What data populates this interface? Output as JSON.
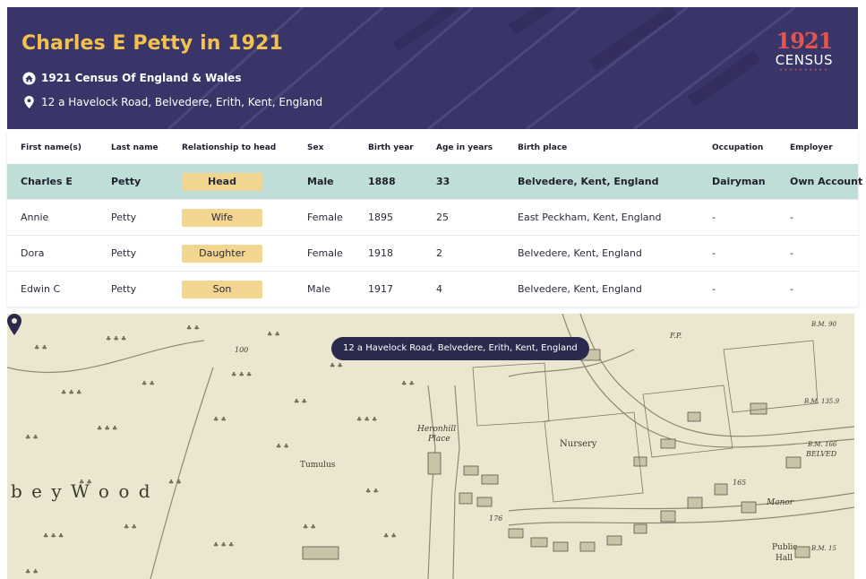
{
  "header": {
    "title": "Charles E Petty in 1921",
    "collection": "1921 Census Of England & Wales",
    "address": "12 a Havelock Road, Belvedere, Erith, Kent, England",
    "logo_year": "1921",
    "logo_word": "CENSUS"
  },
  "table": {
    "columns": [
      "First name(s)",
      "Last name",
      "Relationship to head",
      "Sex",
      "Birth year",
      "Age in years",
      "Birth place",
      "Occupation",
      "Employer"
    ],
    "rows": [
      {
        "first": "Charles E",
        "last": "Petty",
        "relationship": "Head",
        "sex": "Male",
        "birth_year": "1888",
        "age": "33",
        "birth_place": "Belvedere, Kent, England",
        "occupation": "Dairyman",
        "employer": "Own Account"
      },
      {
        "first": "Annie",
        "last": "Petty",
        "relationship": "Wife",
        "sex": "Female",
        "birth_year": "1895",
        "age": "25",
        "birth_place": "East Peckham, Kent, England",
        "occupation": "-",
        "employer": "-"
      },
      {
        "first": "Dora",
        "last": "Petty",
        "relationship": "Daughter",
        "sex": "Female",
        "birth_year": "1918",
        "age": "2",
        "birth_place": "Belvedere, Kent, England",
        "occupation": "-",
        "employer": "-"
      },
      {
        "first": "Edwin C",
        "last": "Petty",
        "relationship": "Son",
        "sex": "Male",
        "birth_year": "1917",
        "age": "4",
        "birth_place": "Belvedere, Kent, England",
        "occupation": "-",
        "employer": "-"
      }
    ]
  },
  "map": {
    "tooltip": "12 a Havelock Road, Belvedere, Erith, Kent, England",
    "labels": {
      "wood": "b e y   W o o d",
      "tumulus": "Tumulus",
      "nursery": "Nursery",
      "heronhill": "Heronhill",
      "place": "Place",
      "manor": "Manor",
      "public": "Public",
      "hall": "Hall",
      "belved": "BELVED",
      "bm_top": "B.M. 90",
      "bm_mid": "B.M. 135.9",
      "bm_low": "B.M. 166",
      "bm_bottom": "B.M. 15",
      "num_100": "100",
      "num_176": "176",
      "num_165": "165",
      "fp": "F.P."
    }
  },
  "colors": {
    "banner": "#3a3568",
    "title": "#f2c14e",
    "highlight_row": "#bfded8",
    "badge": "#f2d58e",
    "tooltip": "#2a2a4e",
    "logo_accent": "#e2564f"
  },
  "icons": [
    "house-icon",
    "map-pin-icon",
    "map-marker-icon"
  ]
}
